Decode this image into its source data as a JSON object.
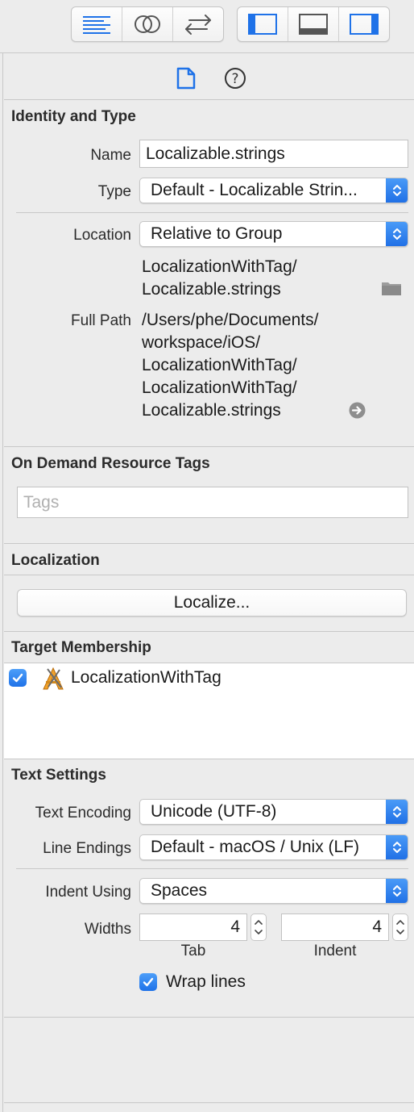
{
  "toolbar": {
    "editor_buttons": [
      "standard-editor-icon",
      "assistant-editor-icon",
      "version-editor-icon"
    ],
    "panel_buttons": [
      "navigator-panel-icon",
      "debug-panel-icon",
      "utilities-panel-icon"
    ]
  },
  "inspector_tabs": [
    "file-inspector-icon",
    "quick-help-icon"
  ],
  "identity": {
    "title": "Identity and Type",
    "name_label": "Name",
    "name_value": "Localizable.strings",
    "type_label": "Type",
    "type_value": "Default - Localizable Strin...",
    "location_label": "Location",
    "location_value": "Relative to Group",
    "location_path_line1": "LocalizationWithTag/",
    "location_path_line2": "Localizable.strings",
    "full_path_label": "Full Path",
    "full_path_lines": [
      "/Users/phe/Documents/",
      "workspace/iOS/",
      "LocalizationWithTag/",
      "LocalizationWithTag/",
      "Localizable.strings"
    ]
  },
  "odr": {
    "title": "On Demand Resource Tags",
    "tags_placeholder": "Tags"
  },
  "localization": {
    "title": "Localization",
    "button_label": "Localize..."
  },
  "target_membership": {
    "title": "Target Membership",
    "target_name": "LocalizationWithTag",
    "checked": true
  },
  "text_settings": {
    "title": "Text Settings",
    "encoding_label": "Text Encoding",
    "encoding_value": "Unicode (UTF-8)",
    "line_endings_label": "Line Endings",
    "line_endings_value": "Default - macOS / Unix (LF)",
    "indent_using_label": "Indent Using",
    "indent_using_value": "Spaces",
    "widths_label": "Widths",
    "tab_width": "4",
    "indent_width": "4",
    "tab_label": "Tab",
    "indent_label": "Indent",
    "wrap_lines_label": "Wrap lines",
    "wrap_lines_checked": true
  },
  "colors": {
    "accent": "#1f72e8",
    "panel_bg": "#ececec"
  }
}
